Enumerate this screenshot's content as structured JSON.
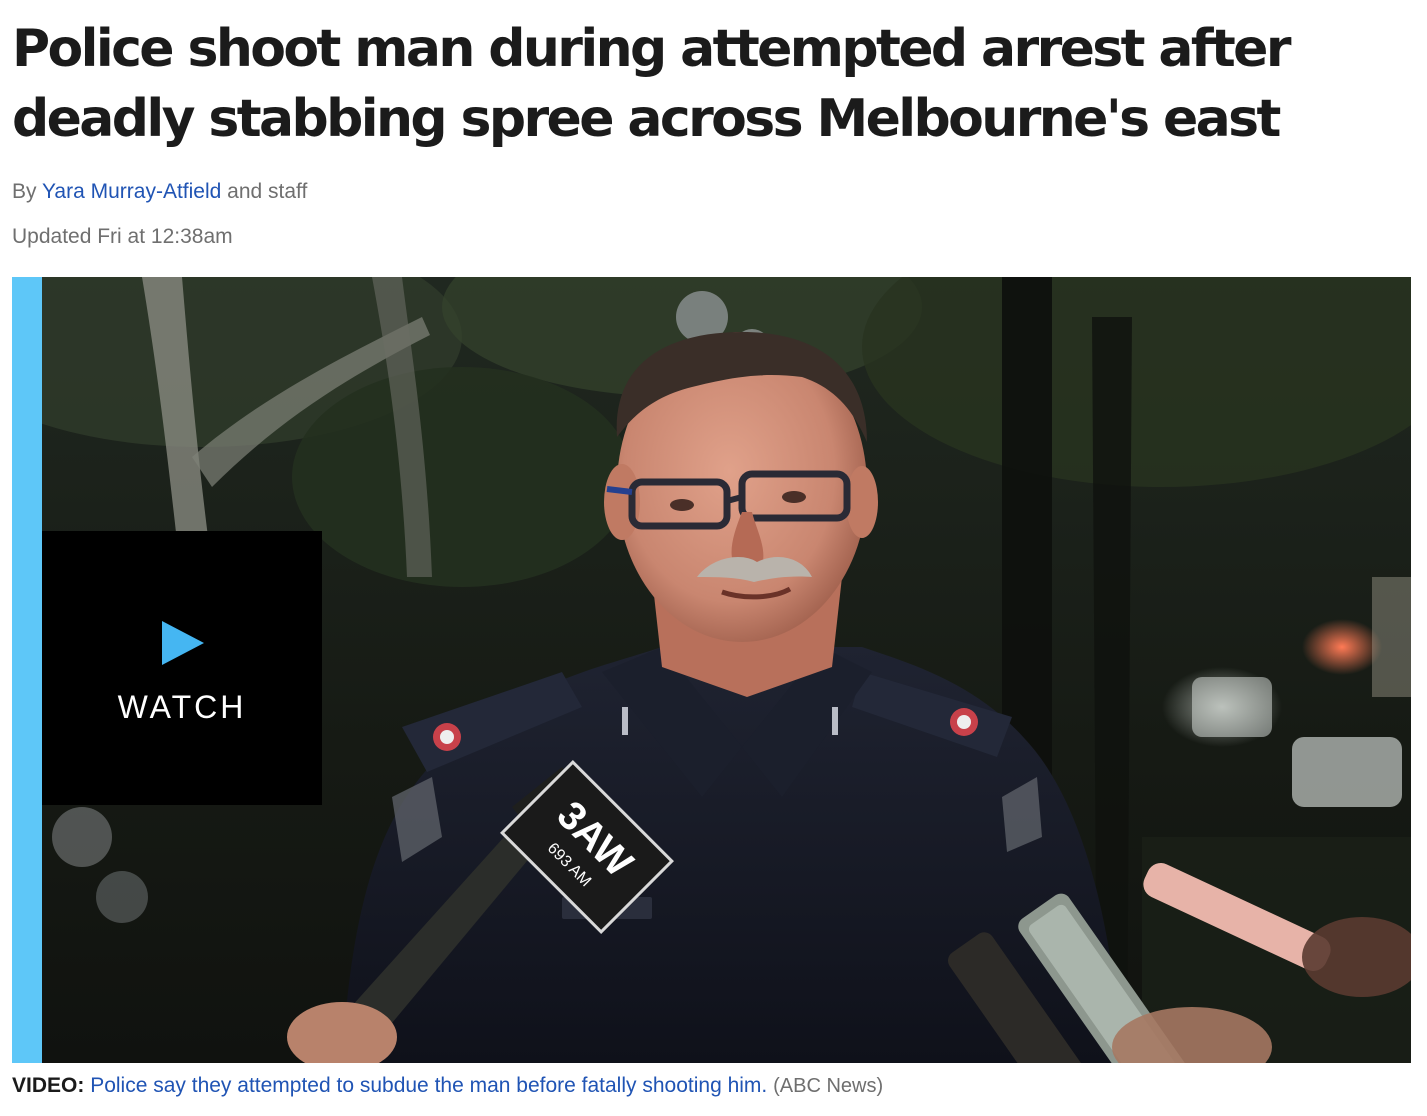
{
  "article": {
    "headline": "Police shoot man during attempted arrest after deadly stabbing spree across Melbourne's east",
    "byline": {
      "prefix": "By",
      "author": "Yara Murray-Atfield",
      "suffix": "and staff"
    },
    "updated": "Updated Fri at 12:38am"
  },
  "video": {
    "watch_label": "WATCH",
    "play_icon": "play-triangle-icon",
    "mic_flag_text": "3AW",
    "mic_flag_subtext": "693 AM",
    "accent_color": "#5ec7f8"
  },
  "caption": {
    "label": "VIDEO:",
    "text": "Police say they attempted to subdue the man before fatally shooting him.",
    "source": "(ABC News)"
  },
  "colors": {
    "link": "#2054b4",
    "meta_text": "#6f6f6f",
    "headline": "#1b1b1b"
  }
}
